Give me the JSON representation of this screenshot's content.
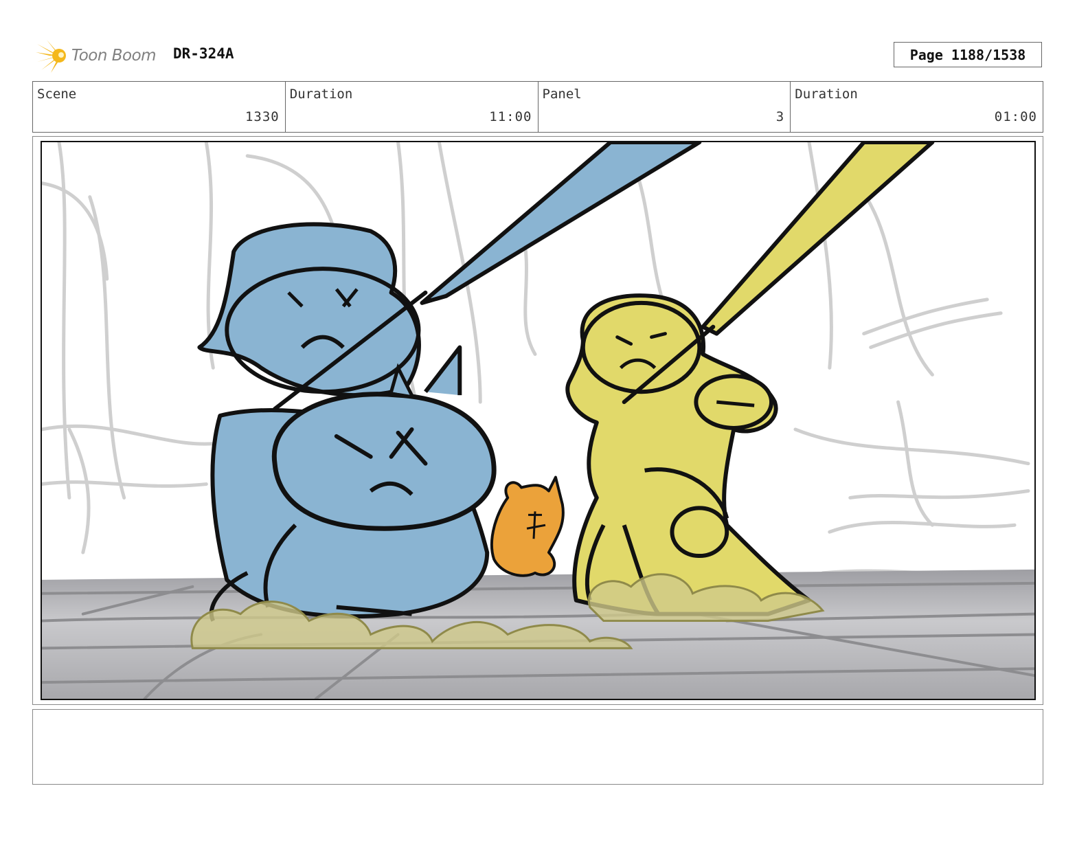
{
  "header": {
    "logo_text": "Toon Boom",
    "code": "DR-324A",
    "page": "Page 1188/1538"
  },
  "info": {
    "scene_label": "Scene",
    "scene_value": "1330",
    "scene_duration_label": "Duration",
    "scene_duration_value": "11:00",
    "panel_label": "Panel",
    "panel_value": "3",
    "panel_duration_label": "Duration",
    "panel_duration_value": "01:00"
  },
  "panel_image": {
    "description_icon": "storyboard-sketch",
    "colors": {
      "blue_character": "#8ab4d2",
      "yellow_character": "#e1d96a",
      "orange_creature": "#eba23a",
      "dust": "#cfc98a",
      "ground": "#b4b4b8"
    }
  },
  "notes": {
    "text": ""
  }
}
